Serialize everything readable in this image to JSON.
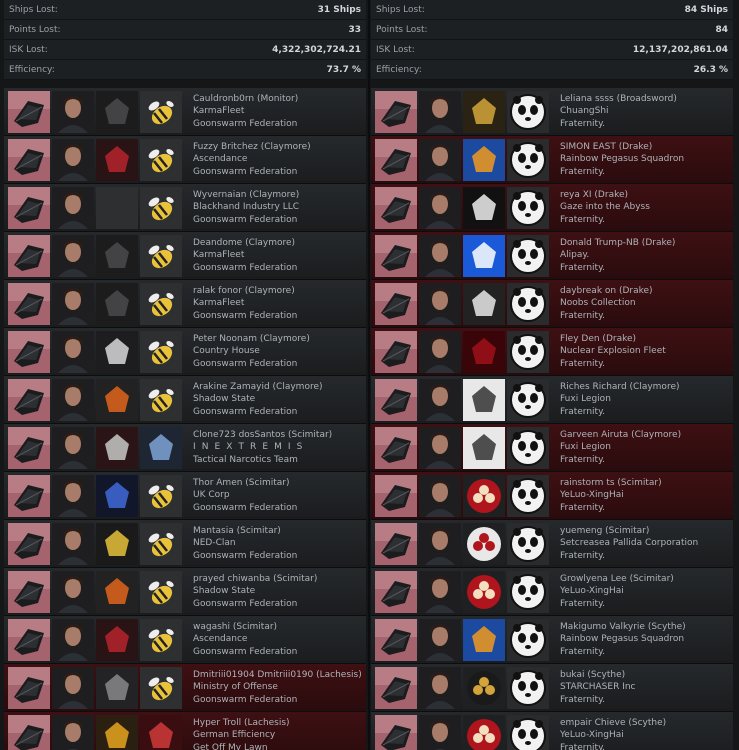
{
  "sides": [
    {
      "stats": {
        "ships_lost": {
          "label": "Ships Lost:",
          "value": "31 Ships"
        },
        "points_lost": {
          "label": "Points Lost:",
          "value": "33"
        },
        "isk_lost": {
          "label": "ISK Lost:",
          "value": "4,322,302,724.21"
        },
        "efficiency": {
          "label": "Efficiency:",
          "value": "73.7 %"
        }
      },
      "rows": [
        {
          "pilot": "Cauldronb0rn (Monitor)",
          "corp": "KarmaFleet",
          "alliance": "Goonswarm Federation",
          "ship_icon": "monitor-ship-icon",
          "pilot_icon": "pilot-portrait",
          "corp_icon": "unicorn-logo-icon",
          "alliance_icon": "goonswarm-bee-icon",
          "red": false
        },
        {
          "pilot": "Fuzzy Britchez (Claymore)",
          "corp": "Ascendance",
          "alliance": "Goonswarm Federation",
          "ship_icon": "claymore-ship-icon",
          "pilot_icon": "pilot-portrait",
          "corp_icon": "ascendance-logo-icon",
          "alliance_icon": "goonswarm-bee-icon",
          "red": false
        },
        {
          "pilot": "Wyvernaian (Claymore)",
          "corp": "Blackhand Industry LLC",
          "alliance": "Goonswarm Federation",
          "ship_icon": "claymore-ship-icon",
          "pilot_icon": "pilot-portrait",
          "corp_icon": "blank-logo-icon",
          "alliance_icon": "goonswarm-bee-icon",
          "red": false
        },
        {
          "pilot": "Deandome (Claymore)",
          "corp": "KarmaFleet",
          "alliance": "Goonswarm Federation",
          "ship_icon": "claymore-ship-icon",
          "pilot_icon": "pilot-portrait",
          "corp_icon": "unicorn-logo-icon",
          "alliance_icon": "goonswarm-bee-icon",
          "red": false
        },
        {
          "pilot": "ralak fonor (Claymore)",
          "corp": "KarmaFleet",
          "alliance": "Goonswarm Federation",
          "ship_icon": "claymore-ship-icon",
          "pilot_icon": "pilot-portrait",
          "corp_icon": "unicorn-logo-icon",
          "alliance_icon": "goonswarm-bee-icon",
          "red": false
        },
        {
          "pilot": "Peter Noonam (Claymore)",
          "corp": "Country House",
          "alliance": "Goonswarm Federation",
          "ship_icon": "claymore-ship-icon",
          "pilot_icon": "pilot-portrait",
          "corp_icon": "heart-logo-icon",
          "alliance_icon": "goonswarm-bee-icon",
          "red": false
        },
        {
          "pilot": "Arakine Zamayid (Claymore)",
          "corp": "Shadow State",
          "alliance": "Goonswarm Federation",
          "ship_icon": "claymore-ship-icon",
          "pilot_icon": "pilot-portrait",
          "corp_icon": "phoenix-logo-icon",
          "alliance_icon": "goonswarm-bee-icon",
          "red": false
        },
        {
          "pilot": "Clone723 dosSantos (Scimitar)",
          "corp": "I N E X T R E M I S",
          "alliance": "Tactical Narcotics Team",
          "ship_icon": "scimitar-ship-icon",
          "pilot_icon": "pilot-portrait",
          "corp_icon": "skull-logo-icon",
          "alliance_icon": "tnt-logo-icon",
          "red": false
        },
        {
          "pilot": "Thor Amen (Scimitar)",
          "corp": "UK Corp",
          "alliance": "Goonswarm Federation",
          "ship_icon": "scimitar-ship-icon",
          "pilot_icon": "pilot-portrait",
          "corp_icon": "blue-wing-logo-icon",
          "alliance_icon": "goonswarm-bee-icon",
          "red": false
        },
        {
          "pilot": "Mantasia (Scimitar)",
          "corp": "NED-Clan",
          "alliance": "Goonswarm Federation",
          "ship_icon": "scimitar-ship-icon",
          "pilot_icon": "pilot-portrait",
          "corp_icon": "ned-logo-icon",
          "alliance_icon": "goonswarm-bee-icon",
          "red": false
        },
        {
          "pilot": "prayed chiwanba (Scimitar)",
          "corp": "Shadow State",
          "alliance": "Goonswarm Federation",
          "ship_icon": "scimitar-ship-icon",
          "pilot_icon": "pilot-portrait",
          "corp_icon": "phoenix-logo-icon",
          "alliance_icon": "goonswarm-bee-icon",
          "red": false
        },
        {
          "pilot": "wagashi (Scimitar)",
          "corp": "Ascendance",
          "alliance": "Goonswarm Federation",
          "ship_icon": "scimitar-ship-icon",
          "pilot_icon": "pilot-portrait",
          "corp_icon": "ascendance-logo-icon",
          "alliance_icon": "goonswarm-bee-icon",
          "red": false
        },
        {
          "pilot": "Dmitriii01904 Dmitriii0190 (Lachesis)",
          "corp": "Ministry of Offense",
          "alliance": "Goonswarm Federation",
          "ship_icon": "lachesis-ship-icon",
          "pilot_icon": "pilot-portrait",
          "corp_icon": "gargoyle-logo-icon",
          "alliance_icon": "goonswarm-bee-icon",
          "red": true
        },
        {
          "pilot": "Hyper Troll (Lachesis)",
          "corp": "German Efficiency",
          "alliance": "Get Off My Lawn",
          "ship_icon": "lachesis-ship-icon",
          "pilot_icon": "pilot-portrait",
          "corp_icon": "gear-logo-icon",
          "alliance_icon": "helmet-logo-icon",
          "red": true
        }
      ]
    },
    {
      "stats": {
        "ships_lost": {
          "label": "Ships Lost:",
          "value": "84 Ships"
        },
        "points_lost": {
          "label": "Points Lost:",
          "value": "84"
        },
        "isk_lost": {
          "label": "ISK Lost:",
          "value": "12,137,202,861.04"
        },
        "efficiency": {
          "label": "Efficiency:",
          "value": "26.3 %"
        }
      },
      "rows": [
        {
          "pilot": "Leliana ssss (Broadsword)",
          "corp": "ChuangShi",
          "alliance": "Fraternity.",
          "ship_icon": "broadsword-ship-icon",
          "pilot_icon": "pilot-portrait",
          "corp_icon": "griffin-logo-icon",
          "alliance_icon": "fraternity-panda-icon",
          "red": false
        },
        {
          "pilot": "SIMON EAST (Drake)",
          "corp": "Rainbow Pegasus Squadron",
          "alliance": "Fraternity.",
          "ship_icon": "drake-ship-icon",
          "pilot_icon": "pilot-portrait",
          "corp_icon": "pegasus-logo-icon",
          "alliance_icon": "fraternity-panda-icon",
          "red": true
        },
        {
          "pilot": "reya XI (Drake)",
          "corp": "Gaze into the Abyss",
          "alliance": "Fraternity.",
          "ship_icon": "drake-ship-icon",
          "pilot_icon": "pilot-portrait",
          "corp_icon": "eye-logo-icon",
          "alliance_icon": "fraternity-panda-icon",
          "red": true
        },
        {
          "pilot": "Donald Trump-NB (Drake)",
          "corp": "Alipay.",
          "alliance": "Fraternity.",
          "ship_icon": "drake-ship-icon",
          "pilot_icon": "pilot-portrait",
          "corp_icon": "alipay-logo-icon",
          "alliance_icon": "fraternity-panda-icon",
          "red": true
        },
        {
          "pilot": "daybreak on (Drake)",
          "corp": "Noobs Collection",
          "alliance": "Fraternity.",
          "ship_icon": "drake-ship-icon",
          "pilot_icon": "pilot-portrait",
          "corp_icon": "eagle-logo-icon",
          "alliance_icon": "fraternity-panda-icon",
          "red": true
        },
        {
          "pilot": "Fley Den (Drake)",
          "corp": "Nuclear Explosion Fleet",
          "alliance": "Fraternity.",
          "ship_icon": "drake-ship-icon",
          "pilot_icon": "pilot-portrait",
          "corp_icon": "red-glow-logo-icon",
          "alliance_icon": "fraternity-panda-icon",
          "red": true
        },
        {
          "pilot": "Riches Richard (Claymore)",
          "corp": "Fuxi Legion",
          "alliance": "Fraternity.",
          "ship_icon": "claymore-ship-icon",
          "pilot_icon": "pilot-portrait",
          "corp_icon": "fuxi-logo-icon",
          "alliance_icon": "fraternity-panda-icon",
          "red": false
        },
        {
          "pilot": "Garveen Airuta (Claymore)",
          "corp": "Fuxi Legion",
          "alliance": "Fraternity.",
          "ship_icon": "claymore-ship-icon",
          "pilot_icon": "pilot-portrait",
          "corp_icon": "fuxi-logo-icon",
          "alliance_icon": "fraternity-panda-icon",
          "red": true
        },
        {
          "pilot": "rainstorm ts (Scimitar)",
          "corp": "YeLuo-XingHai",
          "alliance": "Fraternity.",
          "ship_icon": "scimitar-ship-icon",
          "pilot_icon": "pilot-portrait",
          "corp_icon": "clover-logo-icon",
          "alliance_icon": "fraternity-panda-icon",
          "red": true
        },
        {
          "pilot": "yuemeng (Scimitar)",
          "corp": "Setcreasea Pallida Corporation",
          "alliance": "Fraternity.",
          "ship_icon": "scimitar-ship-icon",
          "pilot_icon": "pilot-portrait",
          "corp_icon": "star-logo-icon",
          "alliance_icon": "fraternity-panda-icon",
          "red": false
        },
        {
          "pilot": "Growlyena Lee (Scimitar)",
          "corp": "YeLuo-XingHai",
          "alliance": "Fraternity.",
          "ship_icon": "scimitar-ship-icon",
          "pilot_icon": "pilot-portrait",
          "corp_icon": "clover-logo-icon",
          "alliance_icon": "fraternity-panda-icon",
          "red": false
        },
        {
          "pilot": "Makigumo Valkyrie (Scythe)",
          "corp": "Rainbow Pegasus Squadron",
          "alliance": "Fraternity.",
          "ship_icon": "scythe-ship-icon",
          "pilot_icon": "pilot-portrait",
          "corp_icon": "pegasus-logo-icon",
          "alliance_icon": "fraternity-panda-icon",
          "red": false
        },
        {
          "pilot": "bukai (Scythe)",
          "corp": "STARCHASER Inc",
          "alliance": "Fraternity.",
          "ship_icon": "scythe-ship-icon",
          "pilot_icon": "pilot-portrait",
          "corp_icon": "starchaser-logo-icon",
          "alliance_icon": "fraternity-panda-icon",
          "red": false
        },
        {
          "pilot": "empair Chieve (Scythe)",
          "corp": "YeLuo-XingHai",
          "alliance": "Fraternity.",
          "ship_icon": "scythe-ship-icon",
          "pilot_icon": "pilot-portrait",
          "corp_icon": "clover-logo-icon",
          "alliance_icon": "fraternity-panda-icon",
          "red": false
        }
      ]
    }
  ]
}
